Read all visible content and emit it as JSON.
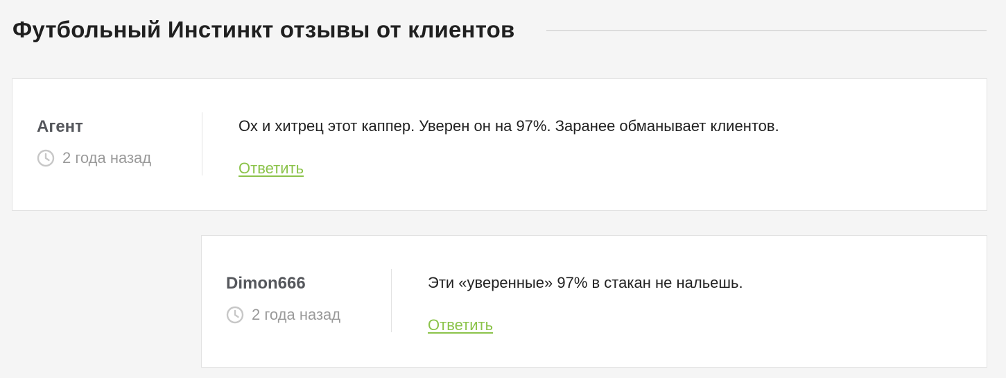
{
  "page": {
    "title": "Футбольный Инстинкт отзывы от клиентов"
  },
  "reviews": [
    {
      "author": "Агент",
      "time": "2 года назад",
      "text": "Ох и хитрец этот каппер. Уверен он на 97%. Заранее обманывает клиентов.",
      "reply_label": "Ответить"
    },
    {
      "author": "Dimon666",
      "time": "2 года назад",
      "text": "Эти «уверенные» 97% в стакан не нальешь.",
      "reply_label": "Ответить"
    }
  ],
  "icons": {
    "time": "clock-icon"
  },
  "colors": {
    "background": "#f5f5f5",
    "card": "#ffffff",
    "accent_link": "#8bc34a",
    "author": "#55575c",
    "muted": "#9a9a9a"
  }
}
